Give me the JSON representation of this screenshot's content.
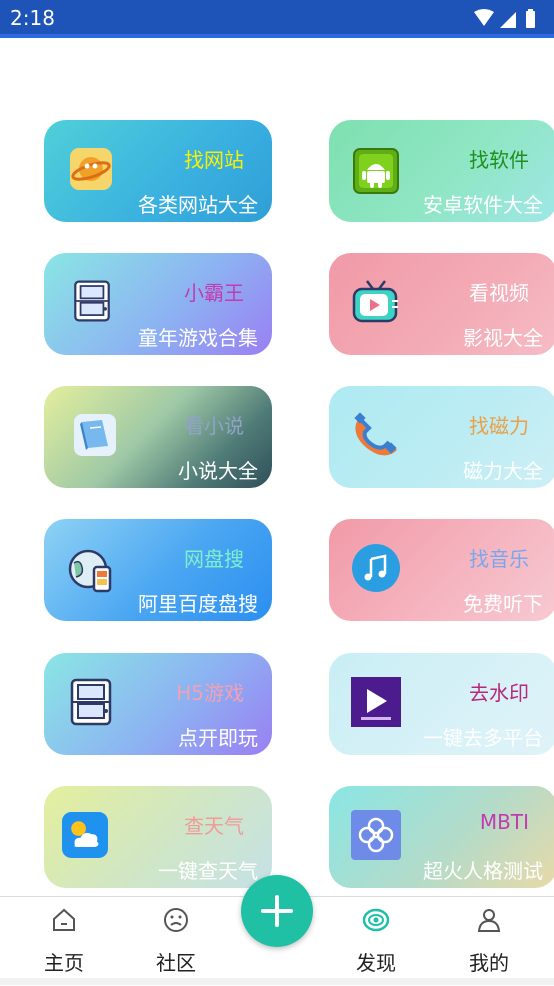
{
  "status_bar": {
    "time": "2:18"
  },
  "cards": [
    {
      "title": "找网站",
      "subtitle": "各类网站大全",
      "icon": "planet-icon",
      "title_color": "#f7f200"
    },
    {
      "title": "找软件",
      "subtitle": "安卓软件大全",
      "icon": "android-icon",
      "title_color": "#1f8f1f"
    },
    {
      "title": "小霸王",
      "subtitle": "童年游戏合集",
      "icon": "game-console-icon",
      "title_color": "#c23bb0"
    },
    {
      "title": "看视频",
      "subtitle": "影视大全",
      "icon": "tv-icon",
      "title_color": "#ffffff"
    },
    {
      "title": "看小说",
      "subtitle": "小说大全",
      "icon": "book-icon",
      "title_color": "#8fa3c9"
    },
    {
      "title": "找磁力",
      "subtitle": "磁力大全",
      "icon": "magnet-icon",
      "title_color": "#e8a14a"
    },
    {
      "title": "网盘搜",
      "subtitle": "阿里百度盘搜",
      "icon": "cloud-drive-icon",
      "title_color": "#7ff0cc"
    },
    {
      "title": "找音乐",
      "subtitle": "免费听下",
      "icon": "music-icon",
      "title_color": "#7aa6ee"
    },
    {
      "title": "H5游戏",
      "subtitle": "点开即玩",
      "icon": "game-console-icon",
      "title_color": "#f0a1b5"
    },
    {
      "title": "去水印",
      "subtitle": "一键去多平台",
      "icon": "watermark-app-icon",
      "title_color": "#b8277a"
    },
    {
      "title": "查天气",
      "subtitle": "一键查天气",
      "icon": "weather-icon",
      "title_color": "#f19a9a"
    },
    {
      "title": "MBTI",
      "subtitle": "超火人格测试",
      "icon": "clover-icon",
      "title_color": "#c23bb0"
    }
  ],
  "nav": {
    "home": "主页",
    "community": "社区",
    "discover": "发现",
    "mine": "我的"
  },
  "colors": {
    "status_bar": "#1e54b7",
    "fab": "#1fc0a4",
    "nav_active": "#1fc0a4"
  }
}
